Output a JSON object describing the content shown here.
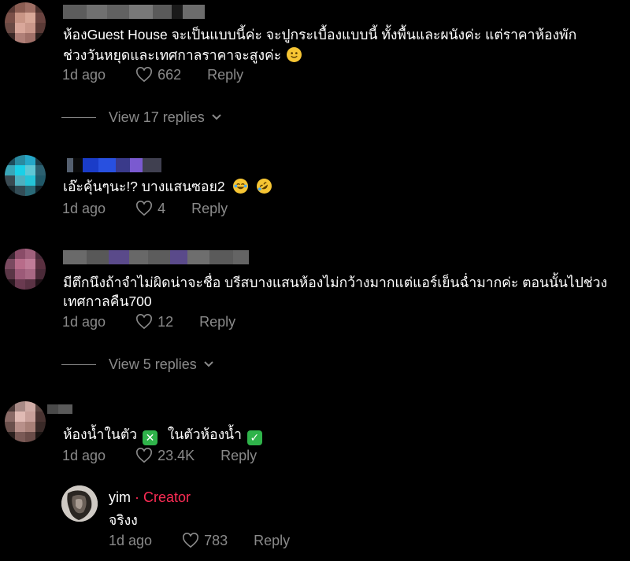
{
  "comments": [
    {
      "text_line1": "ห้องGuest House จะเป็นแบบนี้ค่ะ จะปูกระเบื้องแบบนี้ ทั้งพื้นและผนังค่ะ แต่ราคาห้องพัก",
      "text_line2": "ช่วงวันหยุดและเทศกาลราคาจะสูงค่ะ",
      "time": "1d ago",
      "likes": "662",
      "reply_label": "Reply",
      "view_replies": "View 17 replies",
      "emoji": "slightly-smiling-face"
    },
    {
      "text_line1": "เอ๊ะคุ้นๆนะ!? บางแสนซอย2",
      "time": "1d ago",
      "likes": "4",
      "reply_label": "Reply",
      "emojis": [
        "face-with-tears-of-joy",
        "rolling-on-the-floor-laughing"
      ]
    },
    {
      "text_line1": "มีตึกนึงถ้าจำไม่ผิดน่าจะชื่อ บรีสบางแสนห้องไม่กว้างมากแต่แอร์เย็นฉ่ำมากค่ะ ตอนนั้นไปช่วง",
      "text_line2": "เทศกาลคืน700",
      "time": "1d ago",
      "likes": "12",
      "reply_label": "Reply",
      "view_replies": "View 5 replies"
    },
    {
      "text_a": "ห้องน้ำในตัว",
      "text_b": "ในตัวห้องน้ำ",
      "time": "1d ago",
      "likes": "23.4K",
      "reply_label": "Reply",
      "emojis": [
        "cross-mark-button",
        "check-mark-button"
      ]
    }
  ],
  "creator_reply": {
    "username": "yim",
    "separator": " · ",
    "badge": "Creator",
    "text": "จริงง",
    "time": "1d ago",
    "likes": "783",
    "reply_label": "Reply"
  },
  "colors": {
    "background": "#000000",
    "muted": "#8a8a8a",
    "creator_accent": "#fe2c55",
    "check_green": "#2fb34a",
    "cross_green": "#2fb34a"
  }
}
